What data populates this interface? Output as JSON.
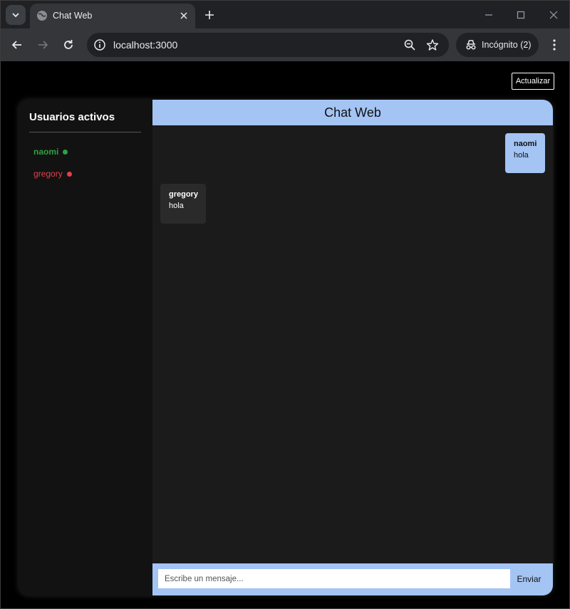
{
  "browser": {
    "tab_title": "Chat Web",
    "url": "localhost:3000",
    "profile_label": "Incógnito (2)"
  },
  "page": {
    "refresh_label": "Actualizar",
    "sidebar": {
      "title": "Usuarios activos",
      "users": [
        {
          "name": "naomi",
          "status": "online",
          "color": "#2ea043"
        },
        {
          "name": "gregory",
          "status": "offline",
          "color": "#e5404a"
        }
      ]
    },
    "chat": {
      "title": "Chat Web",
      "messages": [
        {
          "author": "naomi",
          "text": "hola",
          "mine": true
        },
        {
          "author": "gregory",
          "text": "hola",
          "mine": false
        }
      ],
      "input_placeholder": "Escribe un mensaje...",
      "send_label": "Enviar"
    }
  },
  "colors": {
    "accent": "#a4c4f4",
    "online": "#2ea043",
    "offline": "#e5404a"
  }
}
